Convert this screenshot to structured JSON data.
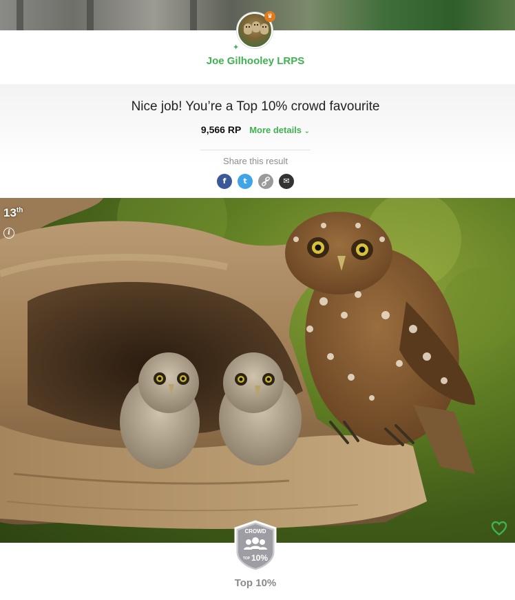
{
  "profile": {
    "username": "Joe Gilhooley LRPS",
    "avatar_icon": "owl-avatar-icon",
    "crown_glyph": "♛",
    "star_glyph": "✦"
  },
  "result": {
    "title": "Nice job! You’re a Top 10% crowd favourite",
    "points": "9,566 RP",
    "more_details_label": "More details",
    "chevron_glyph": "⌄"
  },
  "share": {
    "label": "Share this result",
    "buttons": [
      {
        "name": "facebook",
        "glyph": "f",
        "color": "#3b5998"
      },
      {
        "name": "twitter",
        "glyph": "t",
        "color": "#3fa4e8"
      },
      {
        "name": "copy-link",
        "glyph": "🔗",
        "color": "#9a9a9a"
      },
      {
        "name": "email",
        "glyph": "✉",
        "color": "#333333"
      }
    ]
  },
  "photo": {
    "rank_number": "13",
    "rank_suffix": "th",
    "info_glyph": "i"
  },
  "badge": {
    "top_text": "CROWD",
    "small_text": "TOP",
    "percent_text": "10%",
    "label": "Top 10%"
  },
  "colors": {
    "accent": "#3eb34f",
    "facebook": "#3b5998",
    "twitter": "#3fa4e8"
  }
}
